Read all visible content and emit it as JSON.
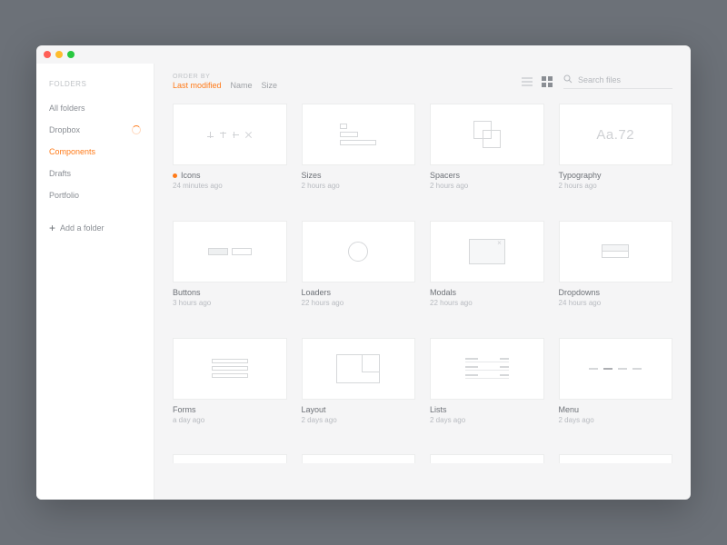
{
  "sidebar": {
    "heading": "FOLDERS",
    "items": [
      {
        "label": "All folders",
        "loading": false,
        "active": false
      },
      {
        "label": "Dropbox",
        "loading": true,
        "active": false
      },
      {
        "label": "Components",
        "loading": false,
        "active": true
      },
      {
        "label": "Drafts",
        "loading": false,
        "active": false
      },
      {
        "label": "Portfolio",
        "loading": false,
        "active": false
      }
    ],
    "add_label": "Add a folder"
  },
  "topbar": {
    "orderby_label": "ORDER BY",
    "sort_options": [
      {
        "label": "Last modified",
        "active": true
      },
      {
        "label": "Name",
        "active": false
      },
      {
        "label": "Size",
        "active": false
      }
    ],
    "search_placeholder": "Search files"
  },
  "files": [
    {
      "name": "Icons",
      "modified": "24 minutes ago",
      "status": "changed",
      "thumb": "icons"
    },
    {
      "name": "Sizes",
      "modified": "2 hours ago",
      "status": null,
      "thumb": "sizes"
    },
    {
      "name": "Spacers",
      "modified": "2 hours ago",
      "status": null,
      "thumb": "spacers"
    },
    {
      "name": "Typography",
      "modified": "2 hours ago",
      "status": null,
      "thumb": "typo"
    },
    {
      "name": "Buttons",
      "modified": "3 hours ago",
      "status": null,
      "thumb": "buttons"
    },
    {
      "name": "Loaders",
      "modified": "22 hours ago",
      "status": null,
      "thumb": "loader"
    },
    {
      "name": "Modals",
      "modified": "22 hours ago",
      "status": null,
      "thumb": "modal"
    },
    {
      "name": "Dropdowns",
      "modified": "24 hours ago",
      "status": null,
      "thumb": "dropdown"
    },
    {
      "name": "Forms",
      "modified": "a day ago",
      "status": null,
      "thumb": "forms"
    },
    {
      "name": "Layout",
      "modified": "2 days ago",
      "status": null,
      "thumb": "layout"
    },
    {
      "name": "Lists",
      "modified": "2 days ago",
      "status": null,
      "thumb": "lists"
    },
    {
      "name": "Menu",
      "modified": "2 days ago",
      "status": null,
      "thumb": "menu"
    }
  ],
  "thumb_typo_text": "Aa.72",
  "colors": {
    "accent": "#ff7a18"
  }
}
